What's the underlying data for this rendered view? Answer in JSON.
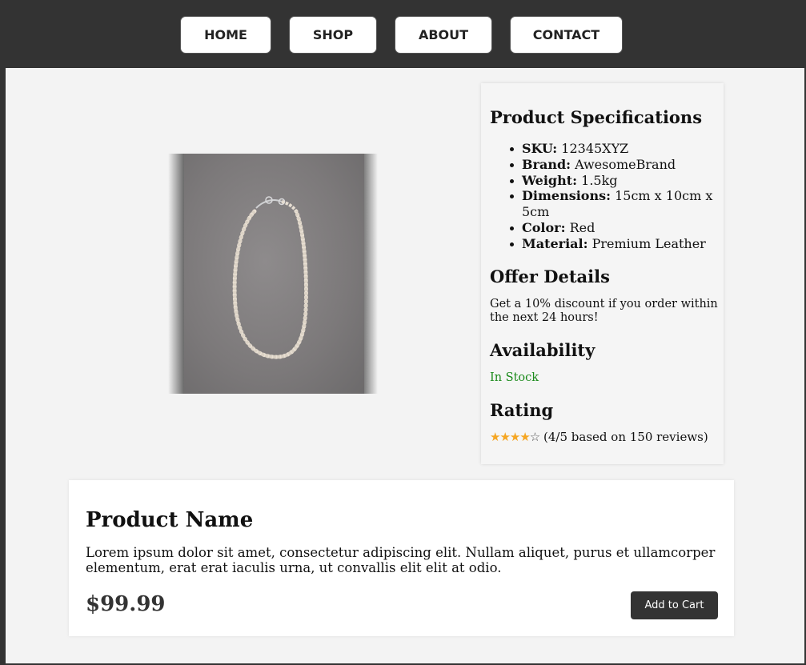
{
  "nav": {
    "items": [
      {
        "label": "HOME"
      },
      {
        "label": "SHOP"
      },
      {
        "label": "ABOUT"
      },
      {
        "label": "CONTACT"
      }
    ]
  },
  "specs": {
    "title": "Product Specifications",
    "items": [
      {
        "key": "SKU:",
        "value": "12345XYZ"
      },
      {
        "key": "Brand:",
        "value": "AwesomeBrand"
      },
      {
        "key": "Weight:",
        "value": "1.5kg"
      },
      {
        "key": "Dimensions:",
        "value": "15cm x 10cm x 5cm"
      },
      {
        "key": "Color:",
        "value": "Red"
      },
      {
        "key": "Material:",
        "value": "Premium Leather"
      }
    ],
    "offer_title": "Offer Details",
    "offer_text": "Get a 10% discount if you order within the next 24 hours!",
    "availability_title": "Availability",
    "availability_text": "In Stock",
    "availability_color": "#1a8a1a",
    "rating_title": "Rating",
    "rating_value": 4,
    "rating_max": 5,
    "rating_text": "(4/5 based on 150 reviews)",
    "star_color": "#f5a623"
  },
  "product": {
    "image_alt": "pearl-necklace-photo",
    "name": "Product Name",
    "description": "Lorem ipsum dolor sit amet, consectetur adipiscing elit. Nullam aliquet, purus et ullamcorper elementum, erat erat iaculis urna, ut convallis elit elit at odio.",
    "price": "$99.99",
    "add_to_cart_label": "Add to Cart"
  },
  "colors": {
    "navbar_bg": "#333333",
    "page_bg": "#f3f3f3",
    "button_dark": "#333333"
  }
}
